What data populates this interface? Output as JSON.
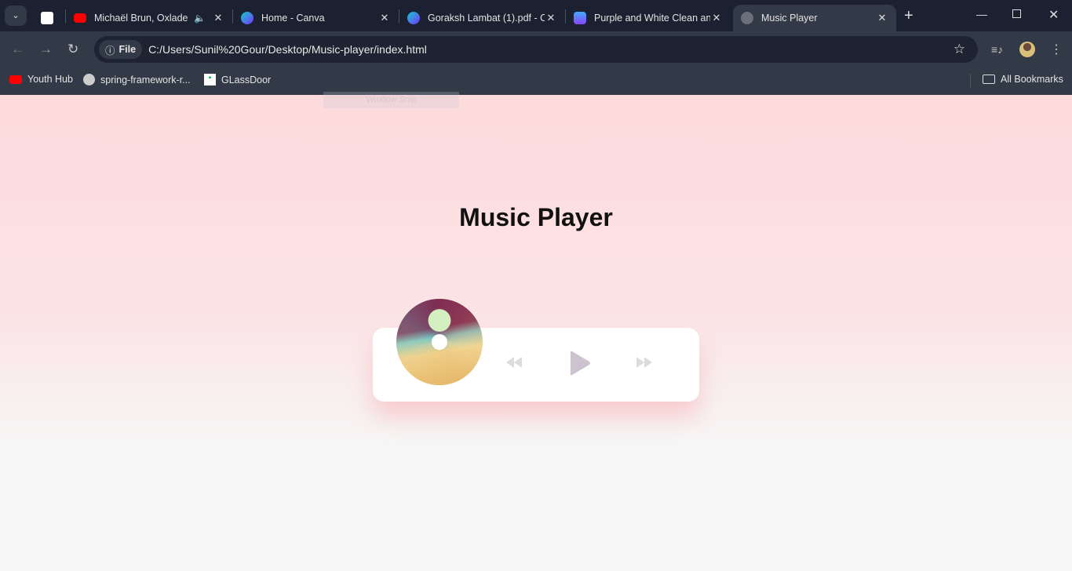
{
  "browser": {
    "tabs": [
      {
        "title": "",
        "icon": "chatgpt-icon"
      },
      {
        "title": "Michaël Brun, Oxlade - ",
        "icon": "youtube-icon",
        "audio": true
      },
      {
        "title": "Home - Canva",
        "icon": "canva-icon"
      },
      {
        "title": "Goraksh Lambat (1).pdf - C",
        "icon": "canva-icon"
      },
      {
        "title": "Purple and White Clean an",
        "icon": "app-icon"
      },
      {
        "title": "Music Player",
        "icon": "globe-icon",
        "active": true
      }
    ],
    "address": {
      "chip": "File",
      "url": "C:/Users/Sunil%20Gour/Desktop/Music-player/index.html"
    },
    "bookmarks": [
      {
        "label": "Youth Hub",
        "icon": "youtube-icon"
      },
      {
        "label": "spring-framework-r...",
        "icon": "globe-icon"
      },
      {
        "label": "GLassDoor",
        "icon": "glassdoor-icon"
      }
    ],
    "all_bookmarks": "All Bookmarks"
  },
  "overlay": {
    "snip": "Window Snip"
  },
  "page": {
    "title": "Music Player",
    "controls": [
      "previous",
      "play",
      "next"
    ],
    "colors": {
      "play": "#cdc2d0",
      "skip": "#dcdcdc"
    }
  }
}
